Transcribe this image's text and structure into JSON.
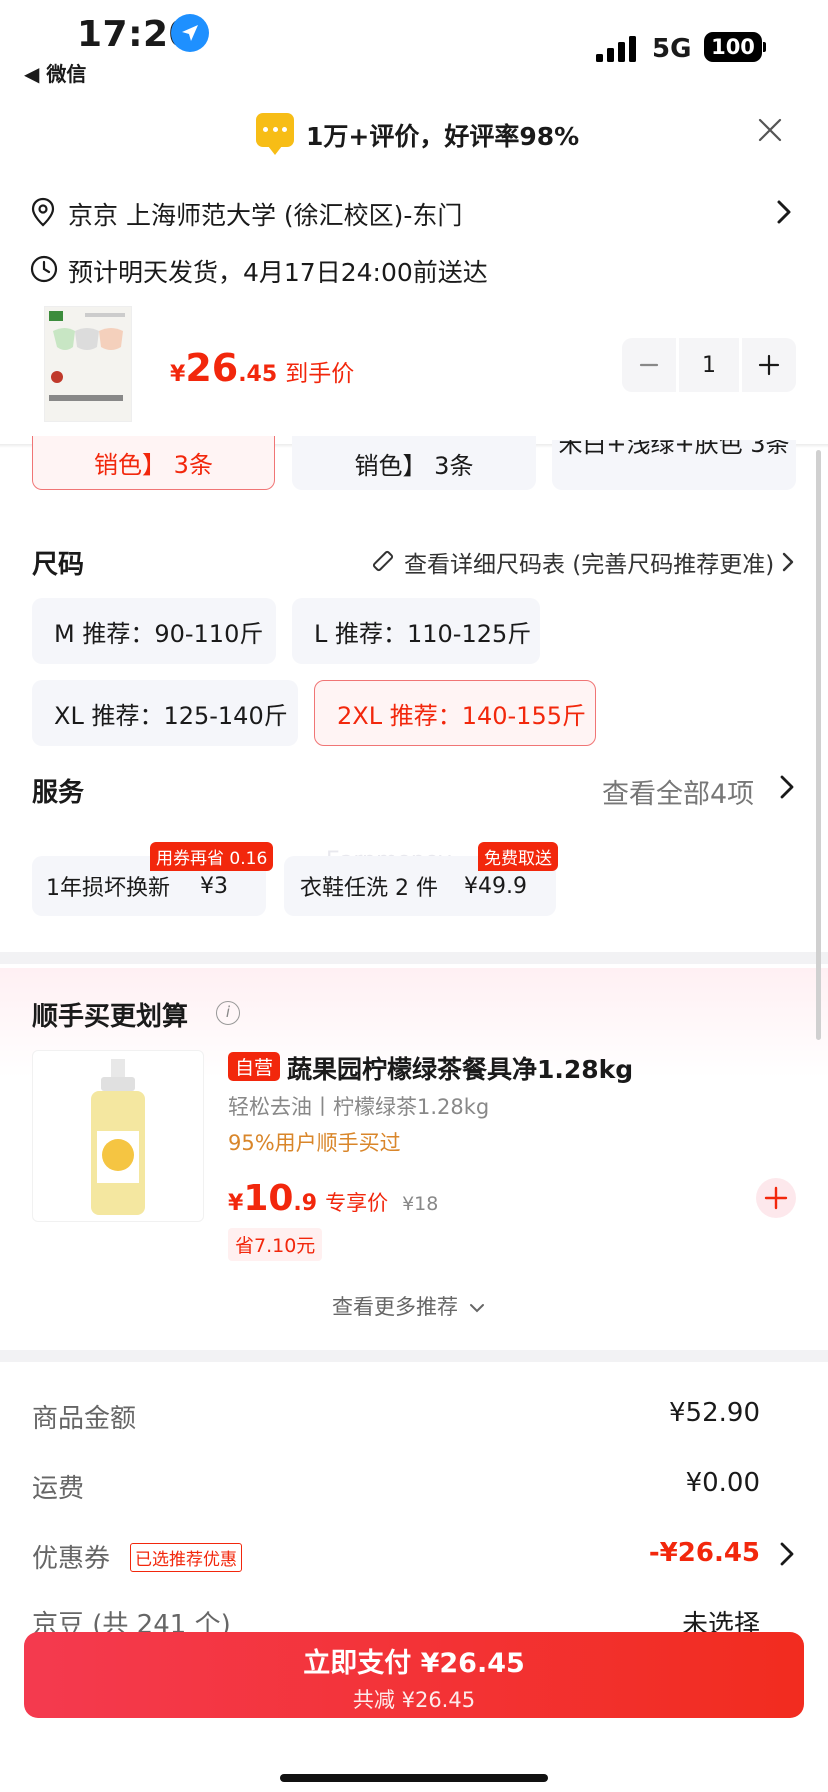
{
  "status_bar": {
    "time": "17:20",
    "back_app": "◀ 微信",
    "network": "5G",
    "battery": "100"
  },
  "review_banner": {
    "text": "1万+评价，好评率98%"
  },
  "address": {
    "location": "京京  上海师范大学 (徐汇校区)-东门",
    "delivery": "预计明天发货，4月17日24:00前送达"
  },
  "product": {
    "price_symbol": "¥",
    "price_int": "26",
    "price_dec": ".45",
    "price_label": "到手价",
    "quantity": "1"
  },
  "color_options": [
    "销色】 3条",
    "销色】 3条",
    "米白+浅绿+肤色 3条"
  ],
  "size": {
    "title": "尺码",
    "chart_link": "查看详细尺码表 (完善尺码推荐更准)",
    "options": [
      "M 推荐：90-110斤",
      "L 推荐：110-125斤",
      "XL 推荐：125-140斤",
      "2XL 推荐：140-155斤"
    ],
    "selected": "2XL 推荐：140-155斤"
  },
  "service": {
    "title": "服务",
    "view_all": "查看全部4项",
    "items": [
      {
        "name": "1年损坏换新",
        "price": "¥3",
        "badge": "用券再省 0.16"
      },
      {
        "name": "衣鞋任洗 2 件",
        "price": "¥49.9",
        "badge": "免费取送"
      }
    ]
  },
  "recommend": {
    "title": "顺手买更划算",
    "info": "i",
    "tag": "自营",
    "name": "蔬果园柠檬绿茶餐具净1.28kg",
    "subtitle": "轻松去油丨柠檬绿茶1.28kg",
    "bought": "95%用户顺手买过",
    "price_symbol": "¥",
    "price_int": "10",
    "price_dec": ".9",
    "price_label": "专享价",
    "original_price": "¥18",
    "save": "省7.10元",
    "more": "查看更多推荐"
  },
  "summary": {
    "rows": [
      {
        "label": "商品金额",
        "value": "¥52.90"
      },
      {
        "label": "运费",
        "value": "¥0.00"
      },
      {
        "label": "优惠券",
        "value": "-¥26.45",
        "tag": "已选推荐优惠"
      },
      {
        "label": "京豆 (共 241 个)",
        "value": "未选择"
      }
    ]
  },
  "pay": {
    "main": "立即支付 ¥26.45",
    "sub": "共减 ¥26.45"
  },
  "colors": {
    "accent": "#f2270c",
    "pay_gradient_start": "#f43a4f",
    "pay_gradient_end": "#f22c1f",
    "chip_bg": "#f5f6fa",
    "review_icon": "#f7bd16",
    "bought_text": "#d9862a"
  }
}
